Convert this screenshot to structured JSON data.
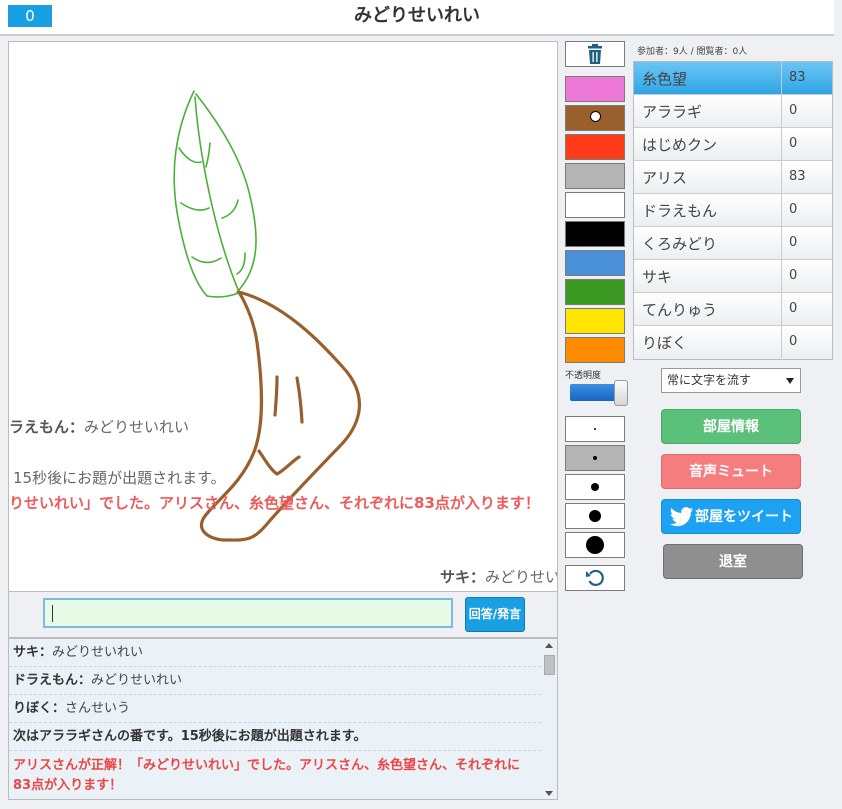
{
  "header": {
    "score": "0",
    "title": "みどりせいれい"
  },
  "flow_messages": {
    "m1_name": "ラえもん：",
    "m1_text": "みどりせいれい",
    "m2": "15秒後にお題が出題されます。",
    "m3": "りせいれい」でした。アリスさん、糸色望さん、それぞれに83点が入ります！",
    "m4_name": "サキ：",
    "m4_text": "みどりせい"
  },
  "answer": {
    "input_value": "",
    "button_label": "回答/発言"
  },
  "log": [
    {
      "name": "サキ：",
      "text": "みどりせいれい"
    },
    {
      "name": "ドラえもん：",
      "text": "みどりせいれい"
    },
    {
      "name": "りぼく：",
      "text": "さんせいう"
    },
    {
      "system": "次はアララギさんの番です。15秒後にお題が出題されます。"
    },
    {
      "alert": "アリスさんが正解！「みどりせいれい」でした。アリスさん、糸色望さん、それぞれに83点が入ります！"
    }
  ],
  "tools": {
    "palette": [
      "#ee78d8",
      "#99602e",
      "#ff3b1a",
      "#b4b4b4",
      "#ffffff",
      "#000000",
      "#4a90d9",
      "#3a9a22",
      "#ffe600",
      "#ff8c00"
    ],
    "selected_color": "#99602e",
    "opacity_label": "不透明度",
    "opacity": 0.92
  },
  "room": {
    "stats": "参加者：9人 / 閲覧者：0人"
  },
  "players": [
    {
      "name": "糸色望",
      "score": "83"
    },
    {
      "name": "アララギ",
      "score": "0"
    },
    {
      "name": "はじめクン",
      "score": "0"
    },
    {
      "name": "アリス",
      "score": "83"
    },
    {
      "name": "ドラえもん",
      "score": "0"
    },
    {
      "name": "くろみどり",
      "score": "0"
    },
    {
      "name": "サキ",
      "score": "0"
    },
    {
      "name": "てんりゅう",
      "score": "0"
    },
    {
      "name": "りぼく",
      "score": "0"
    }
  ],
  "controls": {
    "flow_select": "常に文字を流す",
    "room_info": "部屋情報",
    "mute": "音声ミュート",
    "tweet": "部屋をツイート",
    "leave": "退室"
  },
  "colors": {
    "accent": "#19a0e4",
    "leaf": "#4caf3a",
    "stem": "#99602e"
  }
}
